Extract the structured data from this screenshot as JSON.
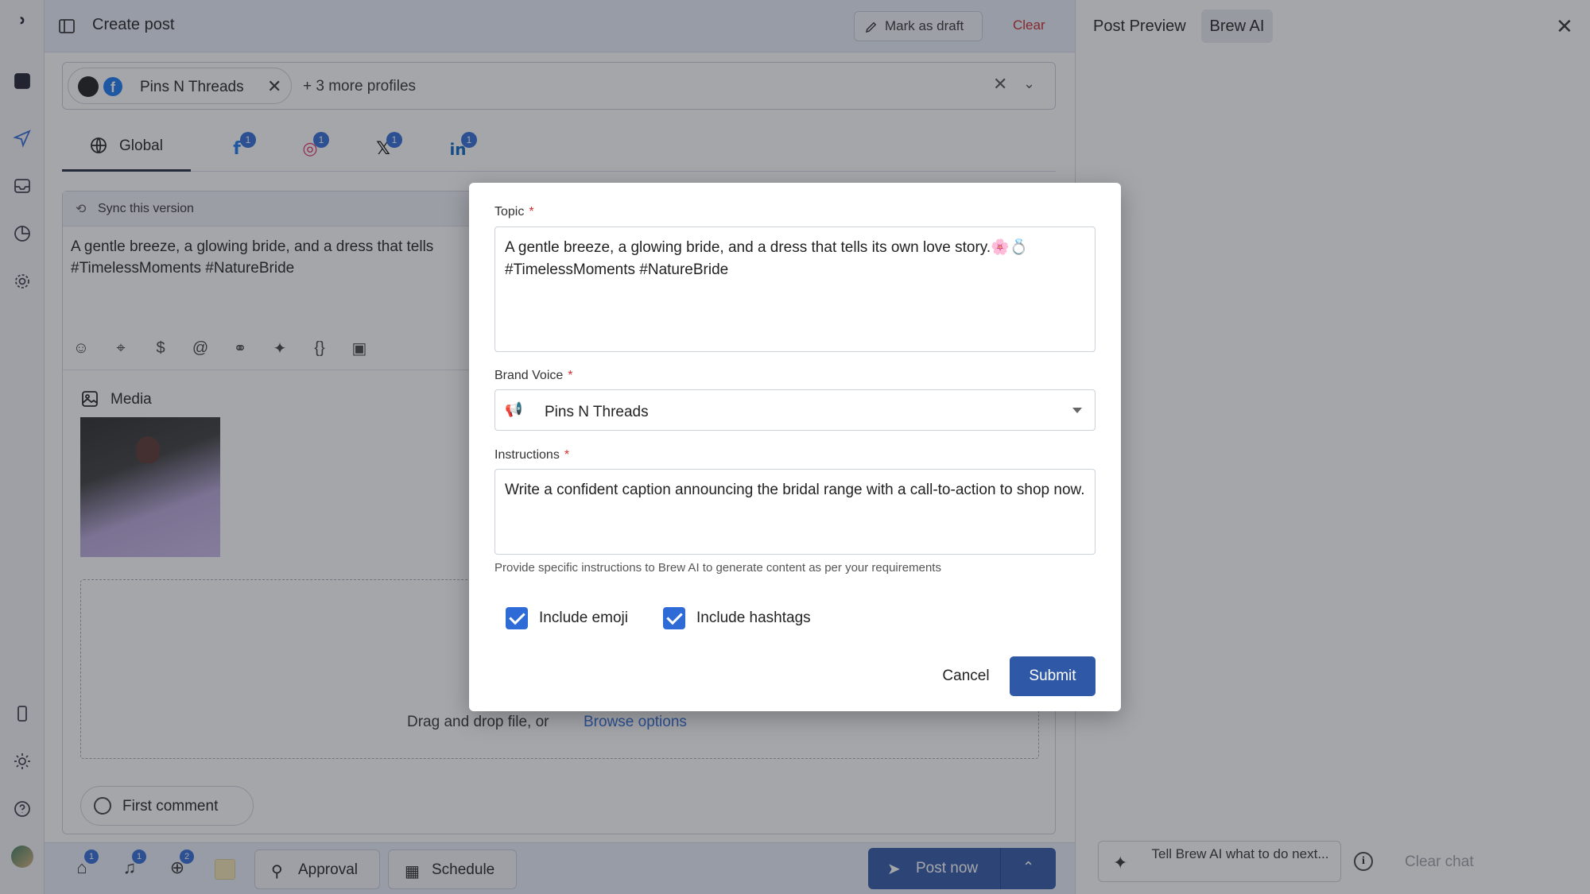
{
  "header": {
    "title": "Create post",
    "mark_draft": "Mark as draft",
    "clear": "Clear"
  },
  "profiles": {
    "chip_name": "Pins N Threads",
    "more": "+ 3 more profiles"
  },
  "tabs": {
    "global": "Global",
    "badges": [
      "1",
      "1",
      "1",
      "1"
    ]
  },
  "editor": {
    "sync_label": "Sync this version",
    "text_line1": "A gentle breeze, a glowing bride, and a dress that tells",
    "text_line2": "#TimelessMoments #NatureBride",
    "media_label": "Media",
    "drop_text": "Drag and drop file, or",
    "browse_link": "Browse options",
    "first_comment": "First comment"
  },
  "bottom": {
    "badges": [
      "1",
      "1",
      "2"
    ],
    "approval": "Approval",
    "schedule": "Schedule",
    "post_now": "Post now"
  },
  "right_panel": {
    "tab_preview": "Post Preview",
    "tab_brew": "Brew AI",
    "prompt": "Tell Brew AI what to do next...",
    "clear_chat": "Clear chat"
  },
  "modal": {
    "topic_label": "Topic",
    "topic_value": "A gentle breeze, a glowing bride, and a dress that tells its own love story.🌸💍\n#TimelessMoments #NatureBride",
    "voice_label": "Brand Voice",
    "voice_value": "Pins N Threads",
    "instructions_label": "Instructions",
    "instructions_value": "Write a confident caption announcing the bridal range with a call-to-action to shop now.",
    "help_text": "Provide specific instructions to Brew AI to generate content as per your requirements",
    "include_emoji": "Include emoji",
    "include_emoji_checked": true,
    "include_hashtags": "Include hashtags",
    "include_hashtags_checked": true,
    "cancel": "Cancel",
    "submit": "Submit",
    "required_mark": "*"
  },
  "colors": {
    "accent": "#2f58a6",
    "badge": "#2f6bd6",
    "danger": "#c92a2a"
  }
}
